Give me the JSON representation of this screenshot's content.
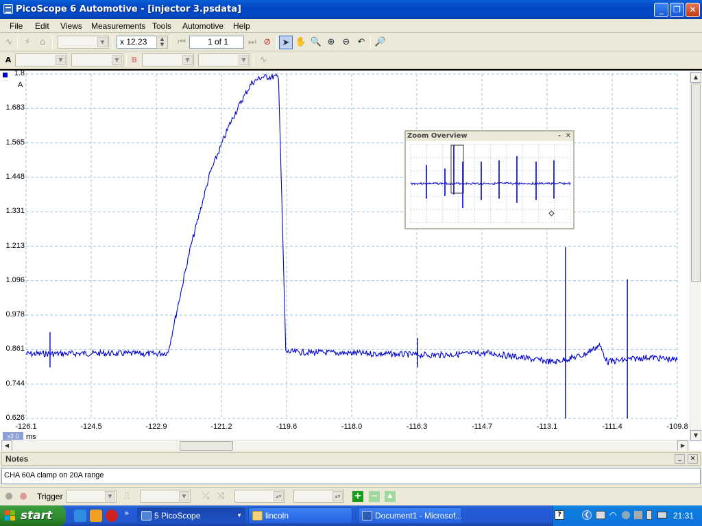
{
  "window": {
    "title": "PicoScope 6 Automotive - [injector 3.psdata]",
    "min_label": "_",
    "max_label": "❐",
    "close_label": "✕"
  },
  "menu": [
    "File",
    "Edit",
    "Views",
    "Measurements",
    "Tools",
    "Automotive",
    "Help"
  ],
  "toolbar": {
    "zoom_value": "x 12.23",
    "page_value": "1 of 1"
  },
  "channel_row": {
    "a_label": "A",
    "b_label": "B"
  },
  "scope": {
    "y_unit": "A",
    "x_unit": "ms",
    "x_zoom_badge": "x2.0",
    "y_ticks": [
      "1.8",
      "1.683",
      "1.565",
      "1.448",
      "1.331",
      "1.213",
      "1.096",
      "0.978",
      "0.861",
      "0.744",
      "0.626"
    ],
    "x_ticks": [
      "-126.1",
      "-124.5",
      "-122.9",
      "-121.2",
      "-119.6",
      "-118.0",
      "-116.3",
      "-114.7",
      "-113.1",
      "-111.4",
      "-109.8"
    ],
    "trace_color": "#0000cc",
    "grid_color": "#9fc3dc",
    "waveform_ms": [
      -126.1,
      -124.2,
      -122.9,
      -122.55,
      -122.0,
      -121.5,
      -121.0,
      -120.7,
      -120.45,
      -120.2,
      -119.88,
      -119.78,
      -119.6,
      -117.5,
      -115.9,
      -114.5,
      -112.9,
      -112.15,
      -111.75,
      -111.55,
      -110.5,
      -109.8
    ],
    "waveform_amps": [
      0.846,
      0.848,
      0.846,
      0.85,
      1.2,
      1.46,
      1.63,
      1.71,
      1.77,
      1.79,
      1.79,
      1.79,
      0.853,
      0.847,
      0.842,
      0.849,
      0.818,
      0.842,
      0.876,
      0.819,
      0.835,
      0.825
    ]
  },
  "zoom_overview": {
    "title": "Zoom Overview",
    "close_label": "✕",
    "min_label": "-"
  },
  "notes": {
    "title": "Notes",
    "text": "CHA 60A clamp on 20A range"
  },
  "bottombar": {
    "trigger_label": "Trigger"
  },
  "taskbar": {
    "start_label": "start",
    "chevron_label": "»",
    "tasks": [
      {
        "label": "5 PicoScope"
      },
      {
        "label": "lincoln"
      },
      {
        "label": "Document1 - Microsof..."
      }
    ],
    "clock": "21:31"
  }
}
